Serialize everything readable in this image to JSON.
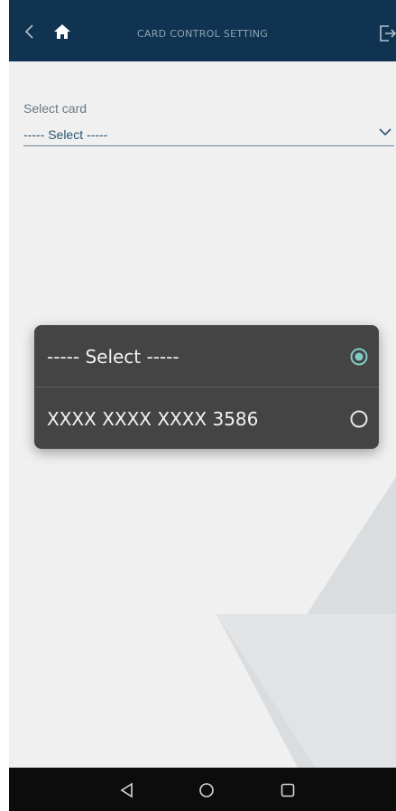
{
  "header": {
    "title": "CARD CONTROL SETTING"
  },
  "form": {
    "label": "Select card",
    "selected_value": "----- Select -----"
  },
  "dialog": {
    "options": [
      {
        "label": "----- Select -----",
        "selected": true
      },
      {
        "label": "XXXX XXXX XXXX 3586",
        "selected": false
      }
    ]
  },
  "colors": {
    "appbar": "#0f3350",
    "dialog": "#444444",
    "accent": "#80cbc4"
  },
  "icons": {
    "back": "chevron-left-icon",
    "home": "home-icon",
    "logout": "logout-icon",
    "dropdown": "chevron-down-icon",
    "nav_back": "triangle-back-icon",
    "nav_home": "circle-home-icon",
    "nav_recent": "square-recent-icon"
  }
}
